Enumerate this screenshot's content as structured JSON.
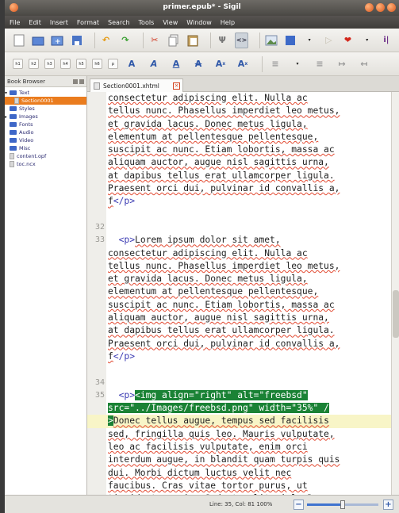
{
  "window": {
    "title": "primer.epub* - Sigil"
  },
  "menu": [
    "File",
    "Edit",
    "Insert",
    "Format",
    "Search",
    "Tools",
    "View",
    "Window",
    "Help"
  ],
  "toolbar2": {
    "headings": [
      "h1",
      "h2",
      "h3",
      "h4",
      "h5",
      "h6",
      "p"
    ]
  },
  "sidebar": {
    "title": "Book Browser",
    "items": [
      {
        "label": "Text",
        "kind": "folder",
        "expanded": true
      },
      {
        "label": "Section0001",
        "kind": "file",
        "selected": true
      },
      {
        "label": "Styles",
        "kind": "folder"
      },
      {
        "label": "Images",
        "kind": "folder"
      },
      {
        "label": "Fonts",
        "kind": "folder"
      },
      {
        "label": "Audio",
        "kind": "folder"
      },
      {
        "label": "Video",
        "kind": "folder"
      },
      {
        "label": "Misc",
        "kind": "folder"
      },
      {
        "label": "content.opf",
        "kind": "file"
      },
      {
        "label": "toc.ncx",
        "kind": "file"
      }
    ]
  },
  "tab": {
    "label": "Section0001.xhtml"
  },
  "code": {
    "lines": [
      {
        "num": "",
        "text": "consectetur adipiscing elit. Nulla ac"
      },
      {
        "num": "",
        "text": "tellus nunc. Phasellus imperdiet leo metus,"
      },
      {
        "num": "",
        "text": "et gravida lacus. Donec metus ligula,"
      },
      {
        "num": "",
        "text": "elementum at pellentesque pellentesque,"
      },
      {
        "num": "",
        "text": "suscipit ac nunc. Etiam lobortis, massa ac"
      },
      {
        "num": "",
        "text": "aliquam auctor, augue nisl sagittis urna,"
      },
      {
        "num": "",
        "text": "at dapibus tellus erat ullamcorper ligula."
      },
      {
        "num": "",
        "text": "Praesent orci dui, pulvinar id convallis a,"
      },
      {
        "num": "",
        "text": "f</p>"
      },
      {
        "num": "",
        "text": ""
      },
      {
        "num": "32",
        "text": ""
      },
      {
        "num": "33",
        "text": "  <p>Lorem ipsum dolor sit amet,"
      },
      {
        "num": "",
        "text": "consectetur adipiscing elit. Nulla ac"
      },
      {
        "num": "",
        "text": "tellus nunc. Phasellus imperdiet leo metus,"
      },
      {
        "num": "",
        "text": "et gravida lacus. Donec metus ligula,"
      },
      {
        "num": "",
        "text": "elementum at pellentesque pellentesque,"
      },
      {
        "num": "",
        "text": "suscipit ac nunc. Etiam lobortis, massa ac"
      },
      {
        "num": "",
        "text": "aliquam auctor, augue nisl sagittis urna,"
      },
      {
        "num": "",
        "text": "at dapibus tellus erat ullamcorper ligula."
      },
      {
        "num": "",
        "text": "Praesent orci dui, pulvinar id convallis a,"
      },
      {
        "num": "",
        "text": "f</p>"
      },
      {
        "num": "",
        "text": ""
      },
      {
        "num": "34",
        "text": ""
      },
      {
        "num": "35",
        "text": "  <p><img align=\"right\" alt=\"freebsd\""
      },
      {
        "num": "",
        "text": "src=\"../Images/freebsd.png\" width=\"35%\" /"
      },
      {
        "num": "",
        "text": ">Donec tellus augue, tempus sed facilisis"
      },
      {
        "num": "",
        "text": "sed, fringilla quis leo. Mauris vulputate,"
      },
      {
        "num": "",
        "text": "leo ac facilisis vulputate, enim orci"
      },
      {
        "num": "",
        "text": "interdum augue, in blandit quam turpis quis"
      },
      {
        "num": "",
        "text": "dui. Morbi dictum luctus velit nec"
      },
      {
        "num": "",
        "text": "faucibus. Cras vitae tortor purus, ut"
      },
      {
        "num": "",
        "text": "tincidunt mauris. Sed at velit nisl. Donec"
      }
    ]
  },
  "status": {
    "text": "Line: 35, Col: 81  100%",
    "zoom_fraction": 0.5
  }
}
